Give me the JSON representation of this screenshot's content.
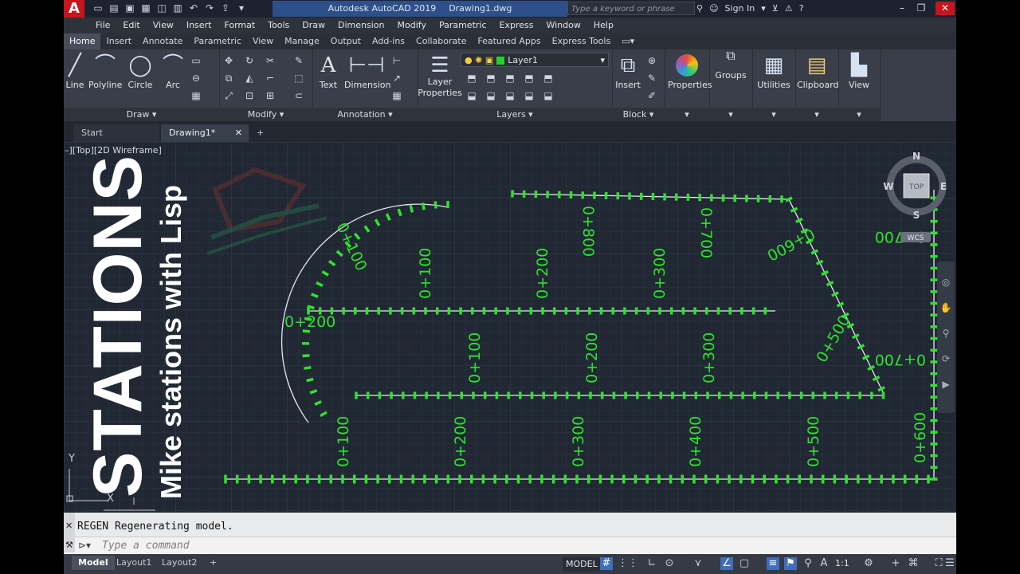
{
  "titlebar": {
    "app_name": "Autodesk AutoCAD 2019",
    "doc_name": "Drawing1.dwg",
    "search_placeholder": "Type a keyword or phrase",
    "signin": "Sign In"
  },
  "menus": [
    "File",
    "Edit",
    "View",
    "Insert",
    "Format",
    "Tools",
    "Draw",
    "Dimension",
    "Modify",
    "Parametric",
    "Express",
    "Window",
    "Help"
  ],
  "ribbon_tabs": [
    "Home",
    "Insert",
    "Annotate",
    "Parametric",
    "View",
    "Manage",
    "Output",
    "Add-ins",
    "Collaborate",
    "Featured Apps",
    "Express Tools"
  ],
  "ribbon": {
    "draw": {
      "title": "Draw",
      "line": "Line",
      "polyline": "Polyline",
      "circle": "Circle",
      "arc": "Arc"
    },
    "modify": {
      "title": "Modify"
    },
    "annotation": {
      "title": "Annotation",
      "text": "Text",
      "dimension": "Dimension"
    },
    "layers": {
      "title": "Layers",
      "layer_properties_1": "Layer",
      "layer_properties_2": "Properties",
      "current_layer": "Layer1"
    },
    "block": {
      "title": "Block",
      "insert": "Insert"
    },
    "properties": "Properties",
    "groups": "Groups",
    "utilities": "Utilities",
    "clipboard": "Clipboard",
    "view": "View"
  },
  "doc_tabs": {
    "start": "Start",
    "drawing": "Drawing1*"
  },
  "viewport_label": "–][Top][2D Wireframe]",
  "viewcube": {
    "n": "N",
    "s": "S",
    "e": "E",
    "w": "W",
    "top": "TOP",
    "wcs": "WCS"
  },
  "overlay": {
    "big": "STATIONS",
    "sub": "Mike stations with Lisp"
  },
  "axis": {
    "y": "Y",
    "x": "X"
  },
  "stations": {
    "arc": [
      "0+100",
      "0+200"
    ],
    "upper": [
      "0+100",
      "0+200",
      "0+300",
      "0+700",
      "0+800"
    ],
    "diag": [
      "0+600"
    ],
    "middle": [
      "0+100",
      "0+200",
      "0+300",
      "0+500"
    ],
    "right": [
      "0+700"
    ],
    "lower": [
      "0+100",
      "0+200",
      "0+300",
      "0+400",
      "0+500",
      "0+600",
      "0+700"
    ]
  },
  "command": {
    "history": "REGEN Regenerating model.",
    "placeholder": "Type a command"
  },
  "status": {
    "model_tab": "Model",
    "layout1": "Layout1",
    "layout2": "Layout2",
    "model": "MODEL",
    "scale": "1:1"
  },
  "colors": {
    "station": "#2ee22e",
    "accent": "#3e6fb8",
    "titlebar": "#2d4f8a"
  }
}
